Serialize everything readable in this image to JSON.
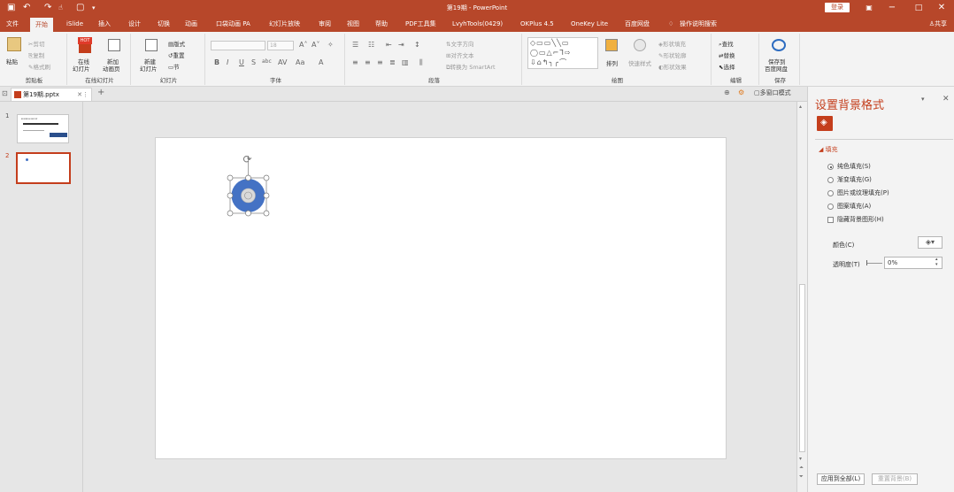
{
  "window": {
    "title": "第19期 - PowerPoint",
    "login_label": "登录",
    "quick_access": [
      "save-icon",
      "undo-icon",
      "redo-icon",
      "touch-mode-icon",
      "new-doc-icon",
      "customize-icon"
    ]
  },
  "tabs": [
    "文件",
    "开始",
    "iSlide",
    "插入",
    "设计",
    "切换",
    "动画",
    "口袋动画 PA",
    "幻灯片放映",
    "审阅",
    "视图",
    "帮助",
    "PDF工具集",
    "LvyhTools(0429)",
    "OKPlus 4.5",
    "OneKey Lite",
    "百度网盘",
    "操作说明搜索"
  ],
  "active_tab": "开始",
  "share_label": "共享",
  "ribbon": {
    "clipboard": {
      "paste": "粘贴",
      "cut": "剪切",
      "copy": "复制",
      "format_painter": "格式刷",
      "group": "剪贴板"
    },
    "online_slides": {
      "online": "在线",
      "online2": "幻灯片",
      "new_anim": "新加",
      "new_anim2": "动画页",
      "group": "在线幻灯片",
      "hot": "HOT"
    },
    "slides": {
      "new_slide": "新建",
      "new_slide2": "幻灯片",
      "layout": "版式",
      "reset": "重置",
      "section": "节",
      "group": "幻灯片"
    },
    "font": {
      "size": "18",
      "group": "字体"
    },
    "paragraph": {
      "text_direction": "文字方向",
      "align_text": "对齐文本",
      "smartart": "转换为 SmartArt",
      "group": "段落"
    },
    "drawing": {
      "arrange": "排列",
      "quick_styles": "快速样式",
      "fill": "形状填充",
      "outline": "形状轮廓",
      "effect": "形状效果",
      "group": "绘图"
    },
    "editing": {
      "find": "查找",
      "replace": "替换",
      "select": "选择",
      "group": "编辑"
    },
    "save": {
      "save_to": "保存到",
      "save_to2": "百度网盘",
      "group": "保存"
    }
  },
  "doc_tab": "第19期.pptx",
  "multi_window": "多窗口模式",
  "slides": [
    {
      "number": "1"
    },
    {
      "number": "2"
    }
  ],
  "thumb1_title": "BUSINESS REPORT",
  "format_pane": {
    "title": "设置背景格式",
    "section": "填充",
    "options": [
      {
        "label": "纯色填充(S)",
        "checked": true
      },
      {
        "label": "渐变填充(G)",
        "checked": false
      },
      {
        "label": "图片或纹理填充(P)",
        "checked": false
      },
      {
        "label": "图案填充(A)",
        "checked": false
      }
    ],
    "hide_bg": "隐藏背景图形(H)",
    "color_label": "颜色(C)",
    "transparency_label": "透明度(T)",
    "transparency_value": "0%",
    "apply_all": "应用到全部(L)",
    "reset_bg": "重置背景(B)"
  },
  "colors": {
    "accent": "#b7472a",
    "shape_fill": "#4472c4"
  }
}
